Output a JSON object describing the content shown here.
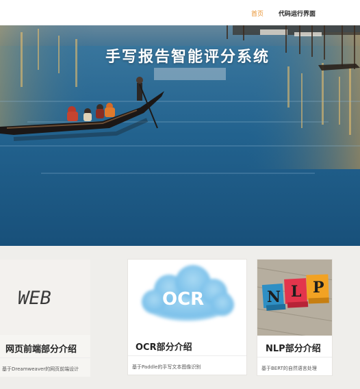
{
  "nav": {
    "home_label": "首页",
    "run_label": "代码运行界面"
  },
  "hero": {
    "title": "手写报告智能评分系统"
  },
  "cards": [
    {
      "image_text": "WEB",
      "title": "网页前端部分介绍",
      "description": "基于Dreamweaver的网页前端设计"
    },
    {
      "image_text": "OCR",
      "title": "OCR部分介绍",
      "description": "基于Paddle的手写文本图像识别"
    },
    {
      "image_letters": [
        "N",
        "L",
        "P"
      ],
      "title": "NLP部分介绍",
      "description": "基于BERT的自然语言处理"
    }
  ],
  "colors": {
    "nav_active": "#e8922f",
    "water": "#1f5d88",
    "page_bg": "#efeeeb"
  }
}
